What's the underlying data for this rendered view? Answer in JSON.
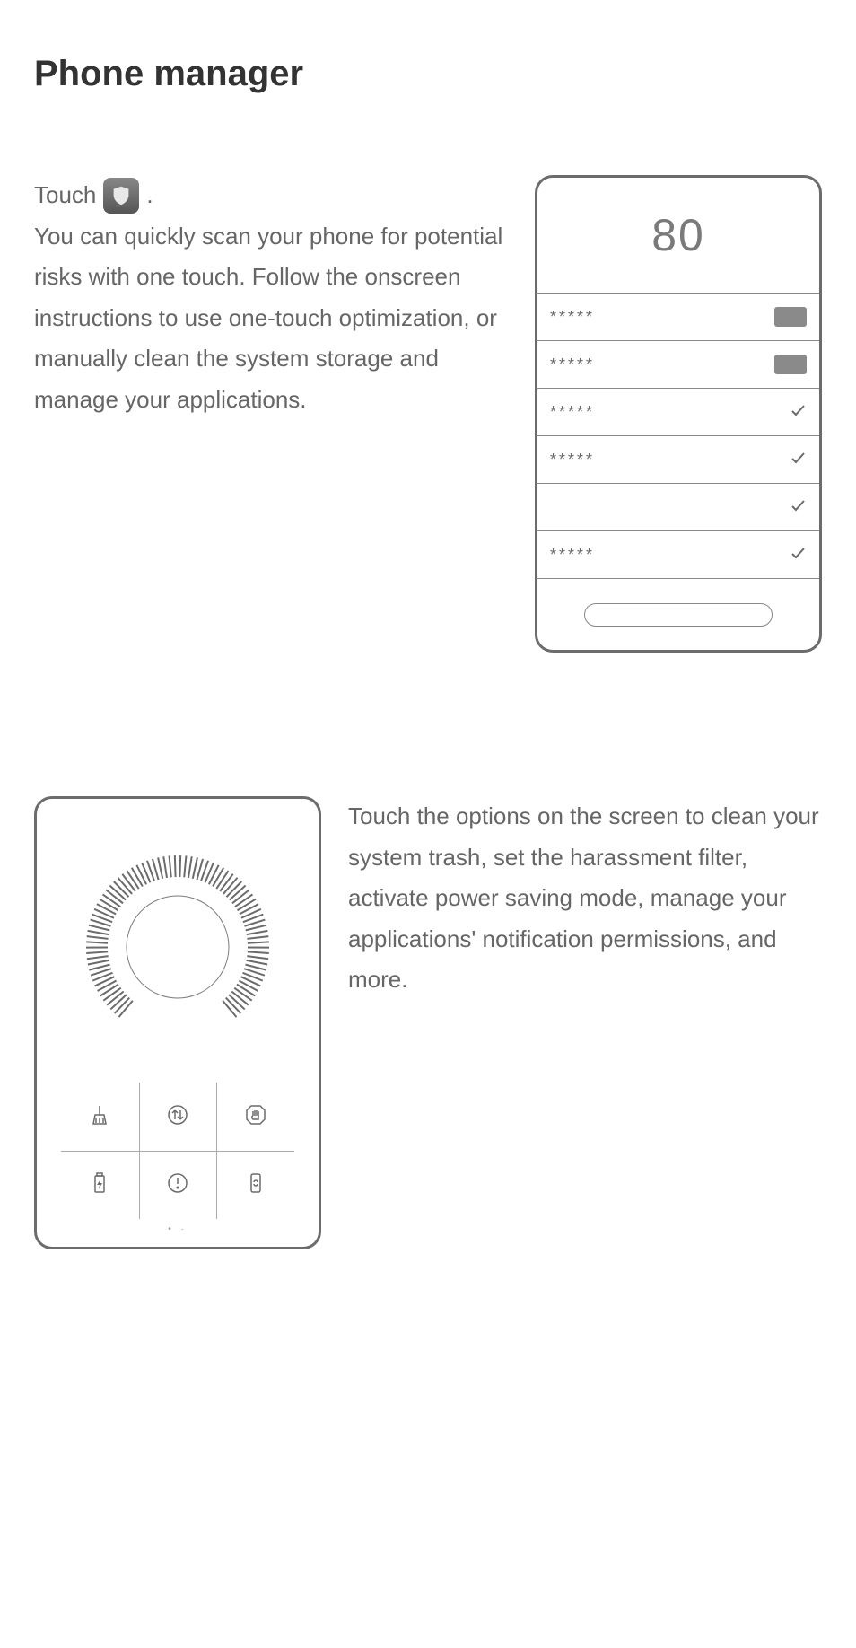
{
  "title": "Phone manager",
  "section1": {
    "touch_word": "Touch",
    "period": ".",
    "body": "You can quickly scan your phone for potential risks with one touch. Follow the onscreen instructions to use one-touch optimization, or manually clean the system storage and manage your applications."
  },
  "mock1": {
    "score": "80",
    "rows": [
      {
        "label": "*****",
        "right": "box"
      },
      {
        "label": "*****",
        "right": "box"
      },
      {
        "label": "*****",
        "right": "check"
      },
      {
        "label": "*****",
        "right": "check"
      },
      {
        "label": "",
        "right": "check"
      },
      {
        "label": "*****",
        "right": "check"
      }
    ]
  },
  "section2": {
    "body": "Touch the options on the screen to clean your system trash, set the harassment filter, activate power saving mode, manage your applications' notification permissions, and more."
  },
  "mock2": {
    "dots": "• ·"
  }
}
